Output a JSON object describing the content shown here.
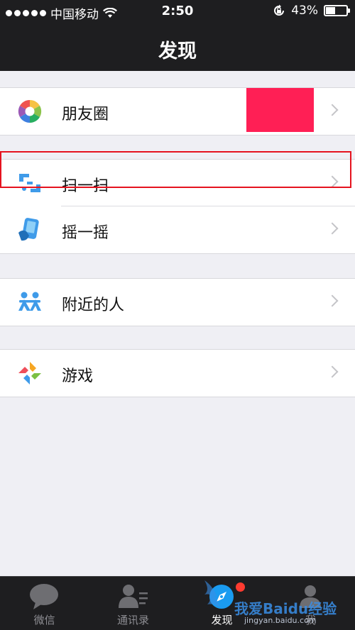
{
  "status_bar": {
    "carrier": "中国移动",
    "time": "2:50",
    "battery_percent": "43%",
    "battery_level": 0.43
  },
  "nav": {
    "title": "发现"
  },
  "groups": [
    {
      "items": [
        {
          "label": "朋友圈",
          "icon": "moments-icon"
        }
      ]
    },
    {
      "items": [
        {
          "label": "扫一扫",
          "icon": "scan-icon"
        },
        {
          "label": "摇一摇",
          "icon": "shake-icon"
        }
      ]
    },
    {
      "items": [
        {
          "label": "附近的人",
          "icon": "people-nearby-icon"
        }
      ]
    },
    {
      "items": [
        {
          "label": "游戏",
          "icon": "games-icon"
        }
      ]
    }
  ],
  "tab_bar": {
    "tabs": [
      {
        "label": "微信",
        "icon": "chat-icon",
        "active": false
      },
      {
        "label": "通讯录",
        "icon": "contacts-icon",
        "active": false
      },
      {
        "label": "发现",
        "icon": "compass-icon",
        "active": true
      },
      {
        "label": "我",
        "icon": "me-icon",
        "active": false
      }
    ]
  },
  "watermark": {
    "text": "我爱Baidu经验",
    "url": "jingyan.baidu.com"
  },
  "colors": {
    "dark_bar": "#1e1e20",
    "background": "#efeff4",
    "highlight_border": "#e5131f",
    "redaction": "#ff1f55",
    "badge": "#ff3b30"
  }
}
